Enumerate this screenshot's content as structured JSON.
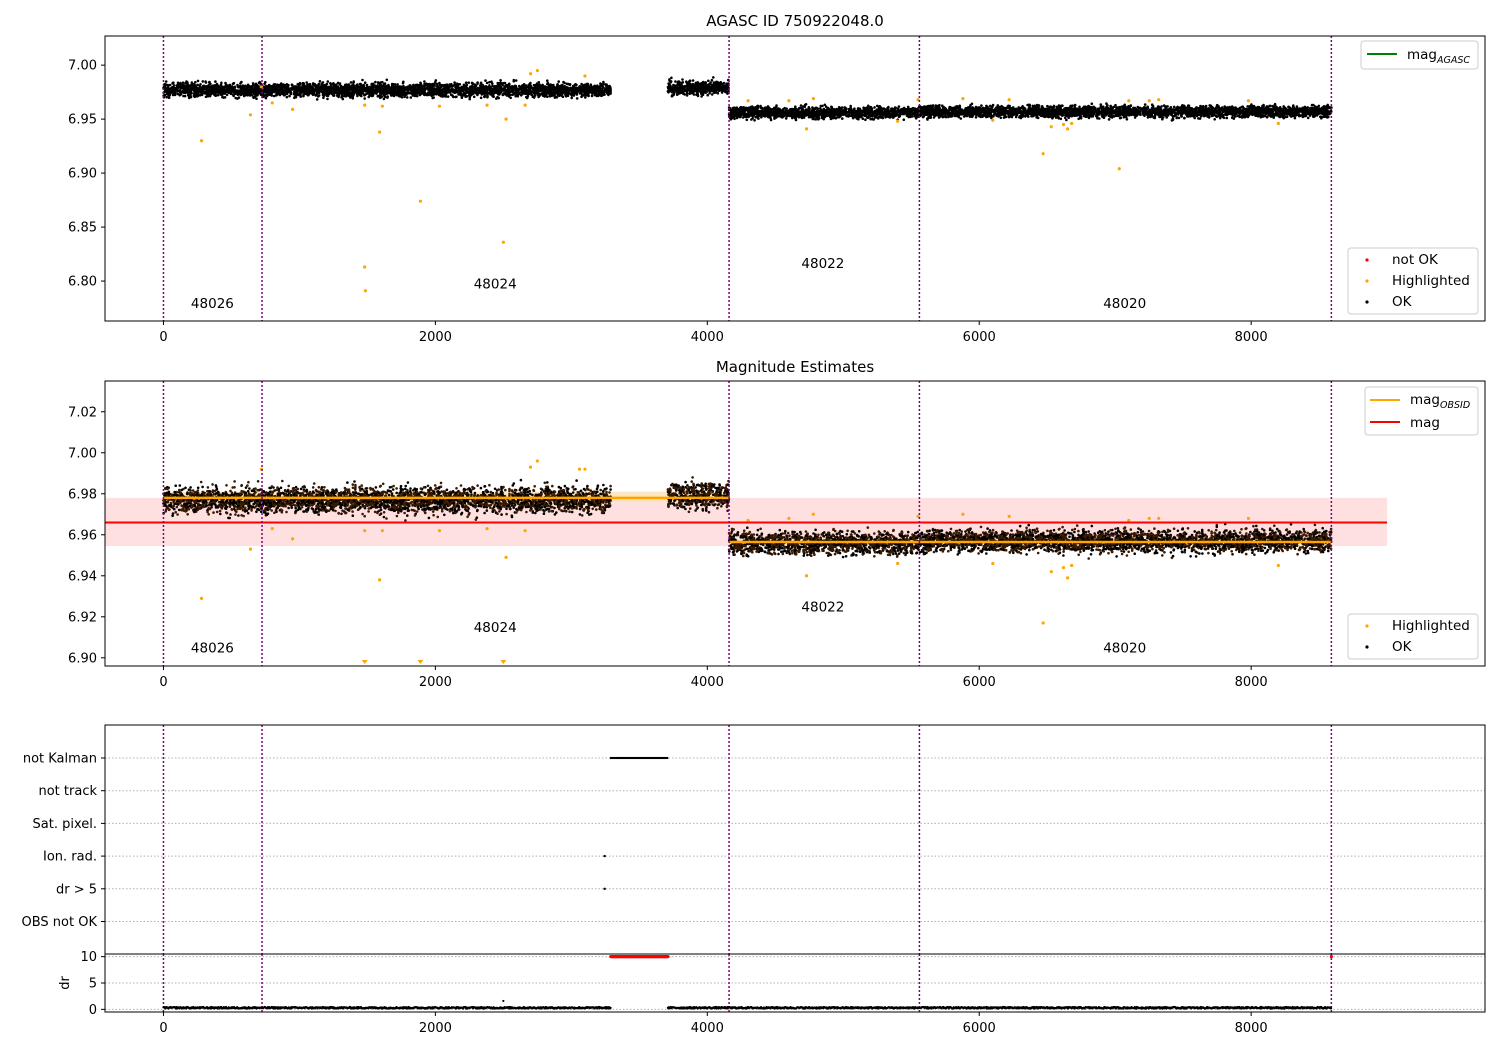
{
  "chart_data": [
    {
      "type": "scatter",
      "title": "AGASC ID 750922048.0",
      "xlabel": "",
      "ylabel": "",
      "xlim": [
        -430,
        9720
      ],
      "ylim": [
        6.763,
        7.027
      ],
      "xticks": [
        0,
        2000,
        4000,
        6000,
        8000
      ],
      "yticks": [
        6.8,
        6.85,
        6.9,
        6.95,
        7.0
      ],
      "ytick_labels": [
        "6.80",
        "6.85",
        "6.90",
        "6.95",
        "7.00"
      ],
      "obsid_boundaries": [
        0,
        725,
        4160,
        5560,
        8590
      ],
      "obsid_labels": [
        {
          "text": "48026",
          "x": 360,
          "y": 6.775
        },
        {
          "text": "48024",
          "x": 2440,
          "y": 6.793
        },
        {
          "text": "48022",
          "x": 4850,
          "y": 6.812
        },
        {
          "text": "48020",
          "x": 7070,
          "y": 6.775
        }
      ],
      "segments": [
        {
          "x": [
            0,
            725
          ],
          "mean": 6.977,
          "spread": 0.007
        },
        {
          "x": [
            725,
            3290
          ],
          "mean": 6.977,
          "spread": 0.007
        },
        {
          "x": [
            3710,
            4160
          ],
          "mean": 6.979,
          "spread": 0.007
        },
        {
          "x": [
            4160,
            5560
          ],
          "mean": 6.956,
          "spread": 0.006
        },
        {
          "x": [
            5560,
            8590
          ],
          "mean": 6.957,
          "spread": 0.006
        }
      ],
      "highlighted_points": [
        [
          280,
          6.93
        ],
        [
          640,
          6.954
        ],
        [
          720,
          6.98
        ],
        [
          800,
          6.965
        ],
        [
          950,
          6.959
        ],
        [
          1480,
          6.813
        ],
        [
          1485,
          6.791
        ],
        [
          1480,
          6.963
        ],
        [
          1590,
          6.938
        ],
        [
          1610,
          6.962
        ],
        [
          1890,
          6.874
        ],
        [
          2030,
          6.962
        ],
        [
          2380,
          6.963
        ],
        [
          2500,
          6.836
        ],
        [
          2520,
          6.95
        ],
        [
          2660,
          6.963
        ],
        [
          2700,
          6.992
        ],
        [
          2750,
          6.995
        ],
        [
          3100,
          6.99
        ],
        [
          4300,
          6.967
        ],
        [
          4600,
          6.967
        ],
        [
          4730,
          6.941
        ],
        [
          4780,
          6.969
        ],
        [
          5400,
          6.948
        ],
        [
          5550,
          6.968
        ],
        [
          5880,
          6.969
        ],
        [
          6100,
          6.949
        ],
        [
          6220,
          6.968
        ],
        [
          6470,
          6.918
        ],
        [
          6530,
          6.943
        ],
        [
          6620,
          6.945
        ],
        [
          6650,
          6.941
        ],
        [
          6680,
          6.946
        ],
        [
          7030,
          6.904
        ],
        [
          7100,
          6.967
        ],
        [
          7250,
          6.967
        ],
        [
          7320,
          6.968
        ],
        [
          7980,
          6.967
        ],
        [
          8200,
          6.946
        ]
      ],
      "series": [
        {
          "name": "not OK",
          "color": "#ff0000"
        },
        {
          "name": "Highlighted",
          "color": "#ffa500"
        },
        {
          "name": "OK",
          "color": "#000000"
        }
      ],
      "legend_line": {
        "name_main": "mag",
        "name_sub": "AGASC",
        "color": "#008000"
      },
      "legend_line_placement": "top-right",
      "legend_points_placement": "lower-right"
    },
    {
      "type": "scatter",
      "title": "Magnitude Estimates",
      "xlabel": "",
      "ylabel": "",
      "xlim": [
        -430,
        9720
      ],
      "ylim": [
        6.896,
        7.035
      ],
      "xticks": [
        0,
        2000,
        4000,
        6000,
        8000
      ],
      "yticks": [
        6.9,
        6.92,
        6.94,
        6.96,
        6.98,
        7.0,
        7.02
      ],
      "ytick_labels": [
        "6.90",
        "6.92",
        "6.94",
        "6.96",
        "6.98",
        "7.00",
        "7.02"
      ],
      "obsid_boundaries": [
        0,
        725,
        4160,
        5560,
        8590
      ],
      "obsid_labels": [
        {
          "text": "48026",
          "x": 360,
          "y": 6.9025
        },
        {
          "text": "48024",
          "x": 2440,
          "y": 6.9125
        },
        {
          "text": "48022",
          "x": 4850,
          "y": 6.9225
        },
        {
          "text": "48020",
          "x": 7070,
          "y": 6.9025
        }
      ],
      "mag": {
        "value": 6.966,
        "band": [
          6.9545,
          6.978
        ],
        "x": [
          -430,
          9000
        ],
        "color": "#ff0000"
      },
      "mag_obsid": [
        {
          "x": [
            0,
            4160
          ],
          "value": 6.978,
          "band": [
            6.976,
            6.981
          ]
        },
        {
          "x": [
            4160,
            8590
          ],
          "value": 6.9565,
          "band": [
            6.955,
            6.958
          ]
        }
      ],
      "segments": [
        {
          "x": [
            0,
            725
          ],
          "mean": 6.977,
          "spread": 0.007
        },
        {
          "x": [
            725,
            3290
          ],
          "mean": 6.977,
          "spread": 0.007
        },
        {
          "x": [
            3710,
            4160
          ],
          "mean": 6.979,
          "spread": 0.007
        },
        {
          "x": [
            4160,
            5560
          ],
          "mean": 6.956,
          "spread": 0.006
        },
        {
          "x": [
            5560,
            8590
          ],
          "mean": 6.957,
          "spread": 0.006
        }
      ],
      "highlighted_points": [
        [
          280,
          6.929
        ],
        [
          640,
          6.953
        ],
        [
          720,
          6.992
        ],
        [
          800,
          6.963
        ],
        [
          950,
          6.958
        ],
        [
          1480,
          6.962
        ],
        [
          1590,
          6.938
        ],
        [
          1610,
          6.962
        ],
        [
          2030,
          6.962
        ],
        [
          2380,
          6.963
        ],
        [
          2520,
          6.949
        ],
        [
          2660,
          6.962
        ],
        [
          2700,
          6.993
        ],
        [
          2750,
          6.996
        ],
        [
          3060,
          6.992
        ],
        [
          3100,
          6.992
        ],
        [
          4300,
          6.967
        ],
        [
          4600,
          6.968
        ],
        [
          4730,
          6.94
        ],
        [
          4780,
          6.97
        ],
        [
          5400,
          6.946
        ],
        [
          5550,
          6.969
        ],
        [
          5880,
          6.97
        ],
        [
          6100,
          6.946
        ],
        [
          6220,
          6.969
        ],
        [
          6470,
          6.917
        ],
        [
          6530,
          6.942
        ],
        [
          6620,
          6.944
        ],
        [
          6650,
          6.939
        ],
        [
          6680,
          6.945
        ],
        [
          7100,
          6.967
        ],
        [
          7250,
          6.968
        ],
        [
          7320,
          6.968
        ],
        [
          7980,
          6.968
        ],
        [
          8200,
          6.945
        ]
      ],
      "clipped_points": [
        1480,
        1890,
        2500
      ],
      "series": [
        {
          "name": "Highlighted",
          "color": "#ffa500"
        },
        {
          "name": "OK",
          "color": "#000000"
        }
      ],
      "legend_lines": [
        {
          "name_main": "mag",
          "name_sub": "OBSID",
          "color": "#ffa500"
        },
        {
          "name_main": "mag",
          "name_sub": "",
          "color": "#ff0000"
        }
      ],
      "legend_line_placement": "top-right",
      "legend_points_placement": "lower-right"
    },
    {
      "type": "scatter",
      "title": "",
      "xlabel": "",
      "ylabel": "",
      "xlim": [
        -430,
        9720
      ],
      "flag_categories": [
        "not Kalman",
        "not track",
        "Sat. pixel.",
        "Ion. rad.",
        "dr > 5",
        "OBS not OK"
      ],
      "obsid_boundaries": [
        0,
        725,
        4160,
        5560,
        8590
      ],
      "flag_events": [
        {
          "flag": "not Kalman",
          "x_range": [
            3290,
            3710
          ]
        },
        {
          "flag": "Ion. rad.",
          "x_range": [
            3245,
            3245
          ]
        },
        {
          "flag": "dr > 5",
          "x_range": [
            3245,
            3245
          ]
        }
      ]
    },
    {
      "type": "scatter",
      "title": "",
      "xlabel": "",
      "ylabel": "dr",
      "xlim": [
        -430,
        9720
      ],
      "ylim": [
        -0.5,
        10.5
      ],
      "xticks": [
        0,
        2000,
        4000,
        6000,
        8000
      ],
      "yticks": [
        0,
        5,
        10
      ],
      "ytick_labels": [
        "0",
        "5",
        "10"
      ],
      "obsid_boundaries": [
        0,
        725,
        4160,
        5560,
        8590
      ],
      "dr_baseline": 0.3,
      "dr_red_range": [
        3290,
        3710
      ],
      "dr_red_value": 10
    }
  ],
  "colors": {
    "ok": "#000000",
    "highlighted": "#ffa500",
    "not_ok": "#ff0000",
    "boundary": "#800080",
    "mag_agasc": "#008000",
    "mag_band": "#ffcccc",
    "mag_obsid_band": "#ffe0b3",
    "grid": "#b0b0b0"
  }
}
